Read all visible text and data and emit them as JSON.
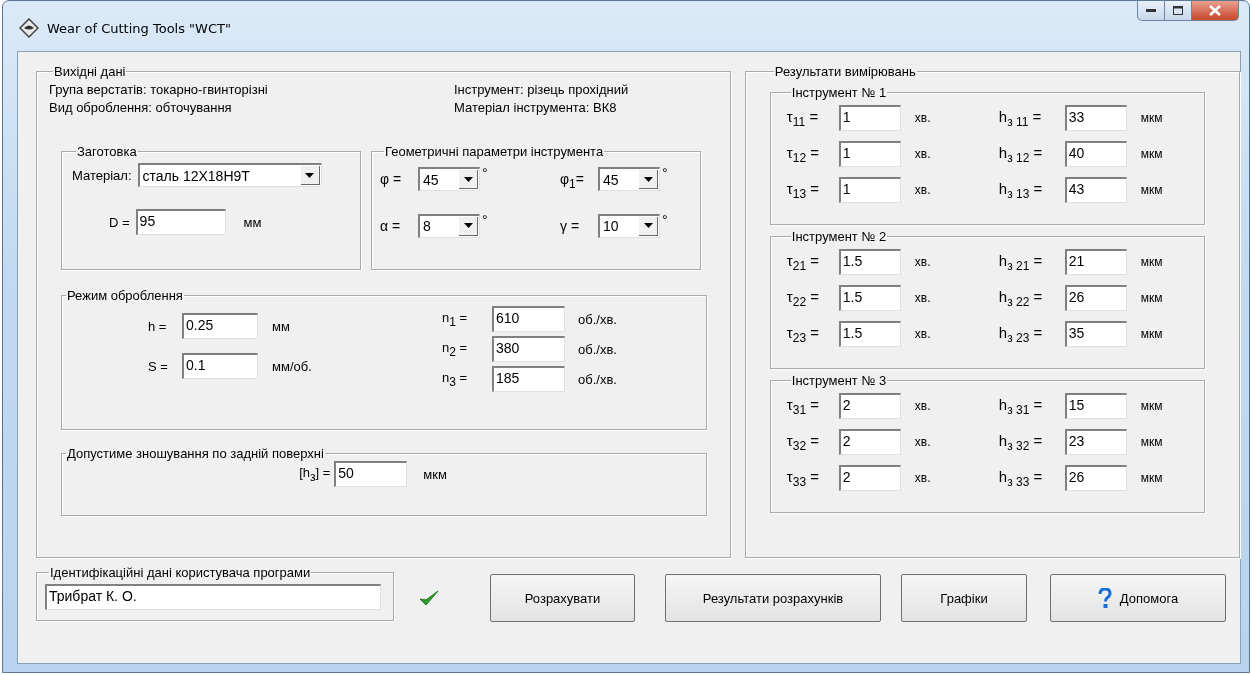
{
  "window": {
    "title": "Wear of Cutting Tools \"WCT\""
  },
  "source_data": {
    "title": "Вихідні дані",
    "lines_left": [
      "Група верстатів: токарно-гвинторізні",
      "Вид оброблення: обточування"
    ],
    "lines_right": [
      "Інструмент: різець прохідний",
      "Матеріал інструмента: ВК8"
    ]
  },
  "workpiece": {
    "title": "Заготовка",
    "material": {
      "label": "Матеріал:",
      "value": "сталь 12Х18Н9Т"
    },
    "diameter": {
      "label": "D =",
      "value": "95",
      "unit": "мм"
    }
  },
  "geometry": {
    "title": "Геометричні параметри інструмента",
    "params": [
      {
        "label": "φ =",
        "value": "45",
        "unit": "°"
      },
      {
        "label": "φ$_{1}$=",
        "value": "45",
        "unit": "°"
      },
      {
        "label": "α =",
        "value": "8",
        "unit": "°"
      },
      {
        "label": "γ =",
        "value": "10",
        "unit": "°"
      }
    ]
  },
  "mode": {
    "title": "Режим оброблення",
    "left": [
      {
        "label": "h =",
        "value": "0.25",
        "unit": "мм"
      },
      {
        "label": "S =",
        "value": "0.1",
        "unit": "мм/об."
      }
    ],
    "right": [
      {
        "label": "n$_{1}$ =",
        "value": "610",
        "unit": "об./хв."
      },
      {
        "label": "n$_{2}$ =",
        "value": "380",
        "unit": "об./хв."
      },
      {
        "label": "n$_{3}$ =",
        "value": "185",
        "unit": "об./хв."
      }
    ]
  },
  "wear_limit": {
    "title": "Допустиме зношування по задній поверхні",
    "label": "[h$_{з}$] =",
    "value": "50",
    "unit": "мкм"
  },
  "results": {
    "title": "Результати вимірювань",
    "tools": [
      {
        "title": "Інструмент № 1",
        "rows": [
          {
            "time": {
              "label": "τ$_{11}$ =",
              "value": "1",
              "unit": "хв."
            },
            "wear": {
              "label": "h$_{з 11}$ =",
              "value": "33",
              "unit": "мкм"
            }
          },
          {
            "time": {
              "label": "τ$_{12}$ =",
              "value": "1",
              "unit": "хв."
            },
            "wear": {
              "label": "h$_{з 12}$ =",
              "value": "40",
              "unit": "мкм"
            }
          },
          {
            "time": {
              "label": "τ$_{13}$ =",
              "value": "1",
              "unit": "хв."
            },
            "wear": {
              "label": "h$_{з 13}$ =",
              "value": "43",
              "unit": "мкм"
            }
          }
        ]
      },
      {
        "title": "Інструмент № 2",
        "rows": [
          {
            "time": {
              "label": "τ$_{21}$ =",
              "value": "1.5",
              "unit": "хв."
            },
            "wear": {
              "label": "h$_{з 21}$ =",
              "value": "21",
              "unit": "мкм"
            }
          },
          {
            "time": {
              "label": "τ$_{22}$ =",
              "value": "1.5",
              "unit": "хв."
            },
            "wear": {
              "label": "h$_{з 22}$ =",
              "value": "26",
              "unit": "мкм"
            }
          },
          {
            "time": {
              "label": "τ$_{23}$ =",
              "value": "1.5",
              "unit": "хв."
            },
            "wear": {
              "label": "h$_{з 23}$ =",
              "value": "35",
              "unit": "мкм"
            }
          }
        ]
      },
      {
        "title": "Інструмент № 3",
        "rows": [
          {
            "time": {
              "label": "τ$_{31}$ =",
              "value": "2",
              "unit": "хв."
            },
            "wear": {
              "label": "h$_{з 31}$ =",
              "value": "15",
              "unit": "мкм"
            }
          },
          {
            "time": {
              "label": "τ$_{32}$ =",
              "value": "2",
              "unit": "хв."
            },
            "wear": {
              "label": "h$_{з 32}$ =",
              "value": "23",
              "unit": "мкм"
            }
          },
          {
            "time": {
              "label": "τ$_{33}$ =",
              "value": "2",
              "unit": "хв."
            },
            "wear": {
              "label": "h$_{з 33}$ =",
              "value": "26",
              "unit": "мкм"
            }
          }
        ]
      }
    ]
  },
  "user": {
    "title": "Ідентифікаційні дані користувача програми",
    "value": "Трибрат К. О."
  },
  "buttons": [
    {
      "label": "Розрахувати",
      "kind": "plain"
    },
    {
      "label": "Результати розрахунків",
      "kind": "plain"
    },
    {
      "label": "Графіки",
      "kind": "plain"
    },
    {
      "label": "Допомога",
      "kind": "help"
    }
  ]
}
